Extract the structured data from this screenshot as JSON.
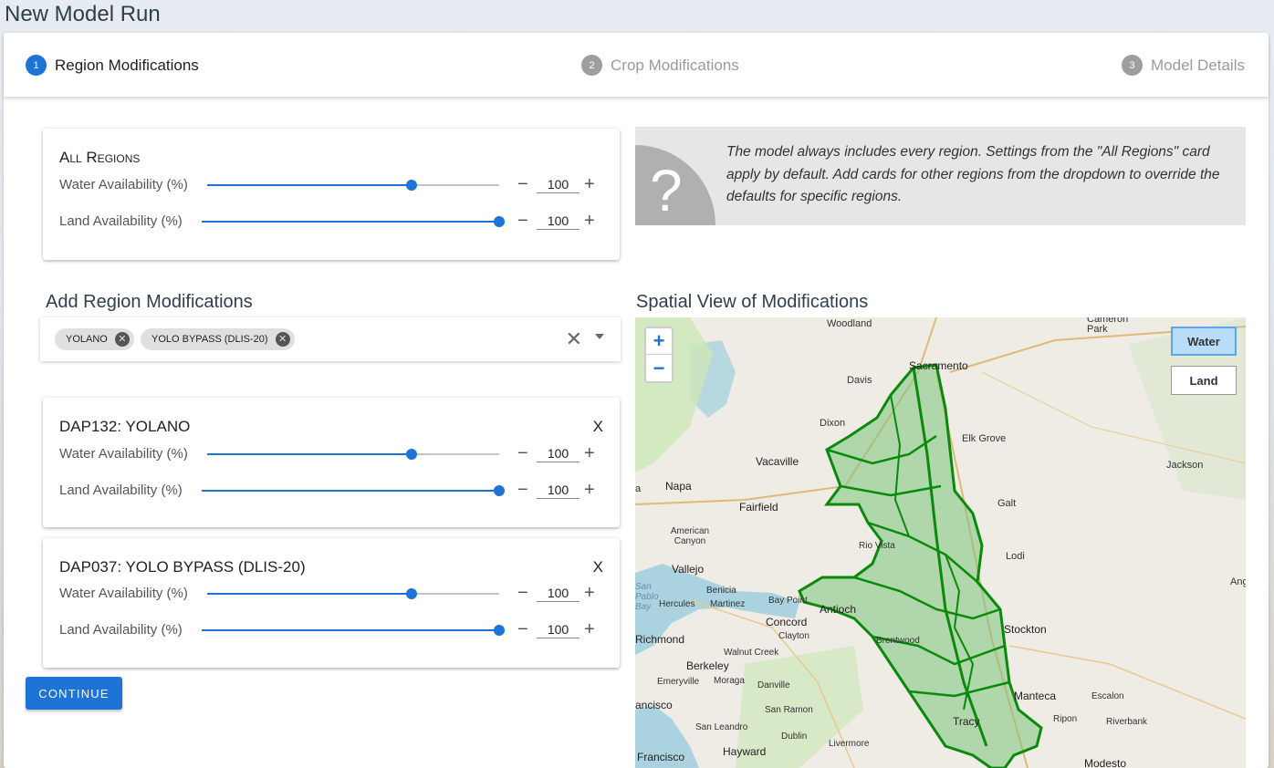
{
  "page": {
    "title": "New Model Run"
  },
  "stepper": {
    "steps": [
      {
        "num": "1",
        "label": "Region Modifications"
      },
      {
        "num": "2",
        "label": "Crop Modifications"
      },
      {
        "num": "3",
        "label": "Model Details"
      }
    ]
  },
  "all_regions": {
    "title": "All Regions",
    "rows": [
      {
        "label": "Water Availability (%)",
        "value": "100",
        "level": 0.7
      },
      {
        "label": "Land Availability (%)",
        "value": "100",
        "level": 1.0
      }
    ]
  },
  "info": {
    "icon": "question-mark-icon",
    "glyph": "?",
    "text": "The model always includes every region. Settings from the \"All Regions\" card apply by default. Add cards for other regions from the dropdown to override the defaults for specific regions."
  },
  "add_region": {
    "heading": "Add Region Modifications",
    "chips": [
      {
        "label": "YOLANO"
      },
      {
        "label": "YOLO BYPASS (DLIS-20)"
      }
    ],
    "clear_glyph": "✕"
  },
  "region_cards": [
    {
      "title": "DAP132: YOLANO",
      "close": "X",
      "rows": [
        {
          "label": "Water Availability (%)",
          "value": "100",
          "level": 0.7
        },
        {
          "label": "Land Availability (%)",
          "value": "100",
          "level": 1.0
        }
      ]
    },
    {
      "title": "DAP037: YOLO BYPASS (DLIS-20)",
      "close": "X",
      "rows": [
        {
          "label": "Water Availability (%)",
          "value": "100",
          "level": 0.7
        },
        {
          "label": "Land Availability (%)",
          "value": "100",
          "level": 1.0
        }
      ]
    }
  ],
  "controls": {
    "minus": "−",
    "plus": "+"
  },
  "continue_label": "CONTINUE",
  "spatial": {
    "heading": "Spatial View of Modifications",
    "zoom_in": "+",
    "zoom_out": "−",
    "layers": {
      "water": "Water",
      "land": "Land"
    },
    "active_layer": "Water",
    "colors": {
      "region_fill": "#7cc47a",
      "region_stroke": "#0a8a0a",
      "water": "#aad3df",
      "park": "#cde8b8"
    },
    "places": [
      "Woodland",
      "Sacramento",
      "Cameron Park",
      "Davis",
      "Dixon",
      "Elk Grove",
      "Vacaville",
      "Jackson",
      "Napa",
      "Fairfield",
      "Galt",
      "American Canyon",
      "Rio Vista",
      "Lodi",
      "Vallejo",
      "San Pablo Bay",
      "Benicia",
      "Hercules",
      "Martinez",
      "Bay Point",
      "Antioch",
      "Concord",
      "Clayton",
      "Brentwood",
      "Stockton",
      "Richmond",
      "Walnut Creek",
      "Berkeley",
      "Emeryville",
      "Moraga",
      "Danville",
      "Manteca",
      "Escalon",
      "San Ramon",
      "Ripon",
      "Riverbank",
      "Tracy",
      "Dublin",
      "San Leandro",
      "Livermore",
      "Hayward",
      "Francisco",
      "Modesto",
      "Ang",
      "ancisco",
      "a"
    ]
  }
}
